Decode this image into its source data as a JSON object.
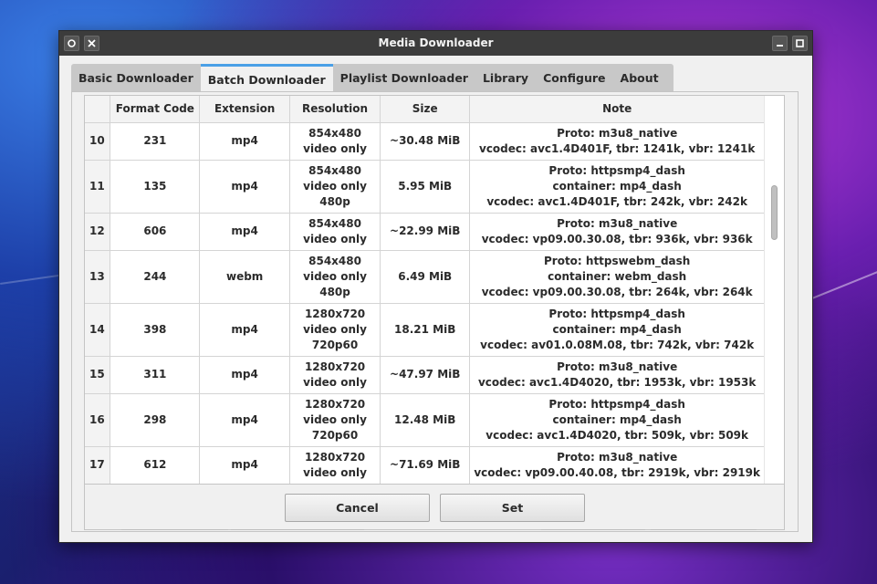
{
  "window": {
    "title": "Media Downloader"
  },
  "tabs": [
    {
      "label": "Basic Downloader",
      "active": false
    },
    {
      "label": "Batch Downloader",
      "active": true
    },
    {
      "label": "Playlist Downloader",
      "active": false
    },
    {
      "label": "Library",
      "active": false
    },
    {
      "label": "Configure",
      "active": false
    },
    {
      "label": "About",
      "active": false
    }
  ],
  "table": {
    "headers": [
      "Format Code",
      "Extension",
      "Resolution",
      "Size",
      "Note"
    ],
    "rows": [
      {
        "num": "10",
        "code": "231",
        "ext": "mp4",
        "res": [
          "854x480",
          "video only"
        ],
        "size": "~30.48 MiB",
        "note": [
          "Proto: m3u8_native",
          "vcodec: avc1.4D401F, tbr: 1241k, vbr: 1241k"
        ]
      },
      {
        "num": "11",
        "code": "135",
        "ext": "mp4",
        "res": [
          "854x480",
          "video only",
          "480p"
        ],
        "size": "5.95 MiB",
        "note": [
          "Proto: httpsmp4_dash",
          "container: mp4_dash",
          "vcodec: avc1.4D401F, tbr: 242k, vbr: 242k"
        ]
      },
      {
        "num": "12",
        "code": "606",
        "ext": "mp4",
        "res": [
          "854x480",
          "video only"
        ],
        "size": "~22.99 MiB",
        "note": [
          "Proto: m3u8_native",
          "vcodec: vp09.00.30.08, tbr: 936k, vbr: 936k"
        ]
      },
      {
        "num": "13",
        "code": "244",
        "ext": "webm",
        "res": [
          "854x480",
          "video only",
          "480p"
        ],
        "size": "6.49 MiB",
        "note": [
          "Proto: httpswebm_dash",
          "container: webm_dash",
          "vcodec: vp09.00.30.08, tbr: 264k, vbr: 264k"
        ]
      },
      {
        "num": "14",
        "code": "398",
        "ext": "mp4",
        "res": [
          "1280x720",
          "video only",
          "720p60"
        ],
        "size": "18.21 MiB",
        "note": [
          "Proto: httpsmp4_dash",
          "container: mp4_dash",
          "vcodec: av01.0.08M.08, tbr: 742k, vbr: 742k"
        ]
      },
      {
        "num": "15",
        "code": "311",
        "ext": "mp4",
        "res": [
          "1280x720",
          "video only"
        ],
        "size": "~47.97 MiB",
        "note": [
          "Proto: m3u8_native",
          "vcodec: avc1.4D4020, tbr: 1953k, vbr: 1953k"
        ]
      },
      {
        "num": "16",
        "code": "298",
        "ext": "mp4",
        "res": [
          "1280x720",
          "video only",
          "720p60"
        ],
        "size": "12.48 MiB",
        "note": [
          "Proto: httpsmp4_dash",
          "container: mp4_dash",
          "vcodec: avc1.4D4020, tbr: 509k, vbr: 509k"
        ]
      },
      {
        "num": "17",
        "code": "612",
        "ext": "mp4",
        "res": [
          "1280x720",
          "video only"
        ],
        "size": "~71.69 MiB",
        "note": [
          "Proto: m3u8_native",
          "vcodec: vp09.00.40.08, tbr: 2919k, vbr: 2919k"
        ]
      }
    ]
  },
  "buttons": {
    "cancel": "Cancel",
    "set": "Set"
  },
  "colors": {
    "titlebar": "#3c3c3c",
    "tab_accent": "#4aa0e6",
    "window_bg": "#f0f0f0"
  },
  "icons": {
    "titlebar_left": [
      "pin-icon",
      "close-icon"
    ],
    "titlebar_right": [
      "minimize-icon",
      "maximize-icon"
    ]
  }
}
